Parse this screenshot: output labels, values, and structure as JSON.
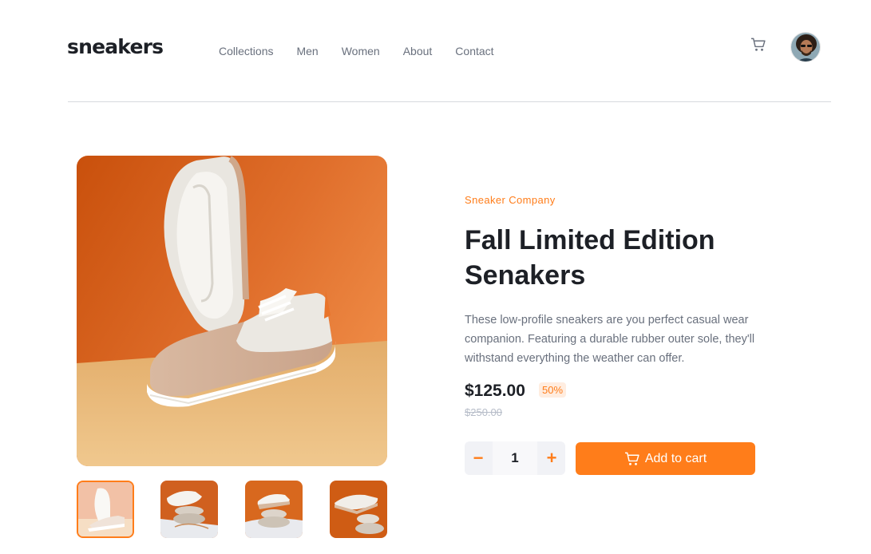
{
  "brand": {
    "logo": "sneakers"
  },
  "nav": {
    "items": [
      "Collections",
      "Men",
      "Women",
      "About",
      "Contact"
    ]
  },
  "header": {
    "cart_icon": "cart-icon",
    "avatar": "user-avatar"
  },
  "product": {
    "company": "Sneaker Company",
    "title": "Fall Limited Edition Senakers",
    "description": "These low-profile sneakers are you perfect casual wear companion. Featuring a durable rubber outer sole, they'll withstand everything the weather can offer.",
    "price": "$125.00",
    "discount": "50%",
    "original_price": "$250.00"
  },
  "gallery": {
    "main_image": "sneaker-photo-1",
    "thumbnails": [
      "sneaker-photo-1",
      "sneaker-photo-2",
      "sneaker-photo-3",
      "sneaker-photo-4"
    ],
    "active_index": 0
  },
  "cart_controls": {
    "minus": "−",
    "quantity": "1",
    "plus": "+",
    "add_label": "Add to cart",
    "add_icon": "cart-icon"
  },
  "colors": {
    "accent": "#ff7d1a",
    "dark": "#1d2026",
    "gray": "#69707d",
    "light": "#f1f2f6"
  }
}
